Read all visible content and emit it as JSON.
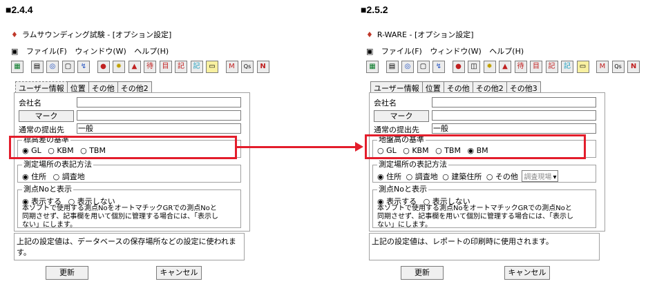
{
  "left": {
    "section": "■2.4.4",
    "window_title": "ラムサウンディング試験 - [オプション設定]",
    "menu": [
      "ファイル(F)",
      "ウィンドウ(W)",
      "ヘルプ(H)"
    ],
    "tabs": [
      "ユーザー情報",
      "位置",
      "その他",
      "その他2"
    ],
    "company_label": "会社名",
    "mark_button": "マーク",
    "submit_label": "通常の提出先",
    "submit_value": "一般",
    "height_group": "標高差の基準",
    "height_options": [
      "◉ GL",
      "○ KBM",
      "○ TBM"
    ],
    "location_group": "測定場所の表記方法",
    "location_options": [
      "◉ 住所",
      "○ 調査地"
    ],
    "point_group": "測点Noと表示",
    "point_options": [
      "◉ 表示する",
      "○ 表示しない"
    ],
    "point_desc": "本ソフトで使用する測点NoをオートマチックGRでの測点Noと同期させず、記事欄を用いて個別に管理する場合には、「表示しない」にします。",
    "bottom_note": "上記の設定値は、データベースの保存場所などの設定に使われます。",
    "update_button": "更新",
    "cancel_button": "キャンセル"
  },
  "right": {
    "section": "■2.5.2",
    "window_title": "R-WARE - [オプション設定]",
    "menu": [
      "ファイル(F)",
      "ウィンドウ(W)",
      "ヘルプ(H)"
    ],
    "tabs": [
      "ユーザー情報",
      "位置",
      "その他",
      "その他2",
      "その他3"
    ],
    "company_label": "会社名",
    "mark_button": "マーク",
    "submit_label": "通常の提出先",
    "submit_value": "一般",
    "height_group": "地盤高の基準",
    "height_options": [
      "○ GL",
      "○ KBM",
      "○ TBM",
      "◉ BM"
    ],
    "location_group": "測定場所の表記方法",
    "location_options": [
      "◉ 住所",
      "○ 調査地",
      "○ 建築住所",
      "○ その他"
    ],
    "location_combo": "調査現場",
    "point_group": "測点Noと表示",
    "point_options": [
      "◉ 表示する",
      "○ 表示しない"
    ],
    "point_desc": "本ソフトで使用する測点NoをオートマチックGRでの測点Noと同期させず、記事欄を用いて個別に管理する場合には、「表示しない」にします。",
    "bottom_note": "上記の設定値は、レポートの印刷時に使用されます。",
    "update_button": "更新",
    "cancel_button": "キャンセル"
  },
  "colors": {
    "highlight": "#e31d2b"
  }
}
